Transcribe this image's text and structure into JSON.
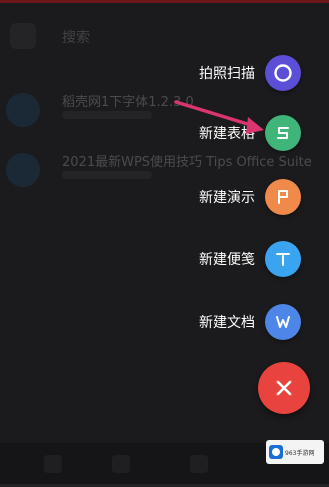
{
  "background": {
    "search_placeholder": "搜索",
    "files": [
      {
        "name": "稻壳网1下字体1.2.3.0"
      },
      {
        "name": "2021最新WPS使用技巧 Tips Office Suite"
      }
    ]
  },
  "menu": {
    "items": [
      {
        "label": "拍照扫描",
        "icon": "camera-scan-icon",
        "color": "#5b4fd8"
      },
      {
        "label": "新建表格",
        "icon": "spreadsheet-s-icon",
        "color": "#3fb57a"
      },
      {
        "label": "新建演示",
        "icon": "presentation-p-icon",
        "color": "#f08a4b"
      },
      {
        "label": "新建便笺",
        "icon": "note-t-icon",
        "color": "#3aa4f0"
      },
      {
        "label": "新建文档",
        "icon": "document-w-icon",
        "color": "#4e86e8"
      }
    ],
    "close": {
      "icon": "close-icon",
      "color": "#e8433f"
    }
  },
  "annotation": {
    "color": "#d9356f"
  },
  "watermark": {
    "text": "963手游网"
  }
}
